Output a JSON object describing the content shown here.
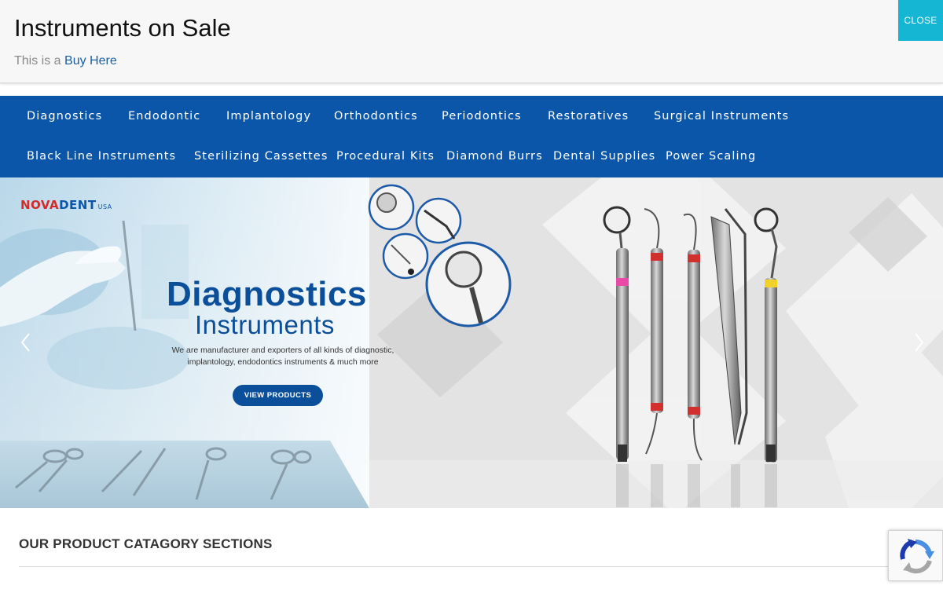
{
  "promo": {
    "title": "Instruments on Sale",
    "subtitle_prefix": "This is a",
    "link_label": "Buy Here",
    "close_label": "CLOSE"
  },
  "nav": {
    "row1": [
      "Diagnostics",
      "Endodontic",
      "Implantology",
      "Orthodontics",
      "Periodontics",
      "Restoratives",
      "Surgical Instruments"
    ],
    "row2": [
      "Black Line Instruments",
      "Sterilizing Cassettes",
      "Procedural Kits",
      "Diamond Burrs",
      "Dental Supplies",
      "Power Scaling"
    ]
  },
  "hero": {
    "logo_left": "NOVA",
    "logo_right": "DENT",
    "logo_suffix": "USA",
    "heading": "Diagnostics",
    "subheading": "Instruments",
    "description_line1": "We are manufacturer and exporters of all kinds of diagnostic,",
    "description_line2": "implantology, endodontics instruments  & much more",
    "button_label": "VIEW PRODUCTS"
  },
  "section": {
    "title": "OUR PRODUCT CATAGORY SECTIONS"
  },
  "icons": {
    "prev": "chevron-left-icon",
    "next": "chevron-right-icon",
    "recaptcha": "recaptcha-icon"
  },
  "colors": {
    "nav_bg": "#0b56a8",
    "close_bg": "#14b6d3",
    "link": "#1a5fa0",
    "hero_heading": "#0b4f9a"
  }
}
